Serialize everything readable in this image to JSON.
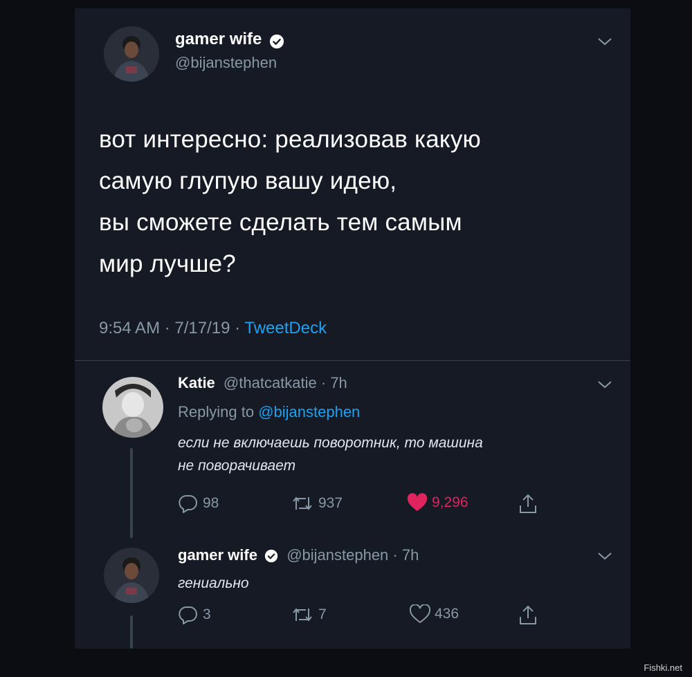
{
  "main_tweet": {
    "author_name": "gamer wife",
    "handle": "@bijanstephen",
    "lines": [
      "вот интересно: реализовав какую",
      "самую глупую вашу идею,",
      "вы сможете сделать тем самым",
      "мир лучше?"
    ],
    "time": "9:54 AM · 7/17/19 · ",
    "source": "TweetDeck"
  },
  "reply1": {
    "author_name": "Katie",
    "meta": "@thatcatkatie · 7h",
    "replying_label": "Replying to ",
    "replying_handle": "@bijanstephen",
    "lines": [
      "если не включаешь поворотник, то машина",
      "не поворачивает"
    ],
    "replies": "98",
    "retweets": "937",
    "likes": "9,296",
    "liked": true
  },
  "reply2": {
    "author_name": "gamer wife",
    "meta": "@bijanstephen · 7h",
    "lines": [
      "гениально"
    ],
    "replies": "3",
    "retweets": "7",
    "likes": "436",
    "liked": false
  },
  "colors": {
    "background": "#151a24",
    "muted": "#8899a6",
    "link": "#1da1f2",
    "like": "#e0245e",
    "verified": "#ffffff"
  },
  "icons": [
    "chevron-down-icon",
    "verified-badge-icon",
    "reply-icon",
    "retweet-icon",
    "heart-icon",
    "share-icon"
  ],
  "watermark": "Fishki.net"
}
